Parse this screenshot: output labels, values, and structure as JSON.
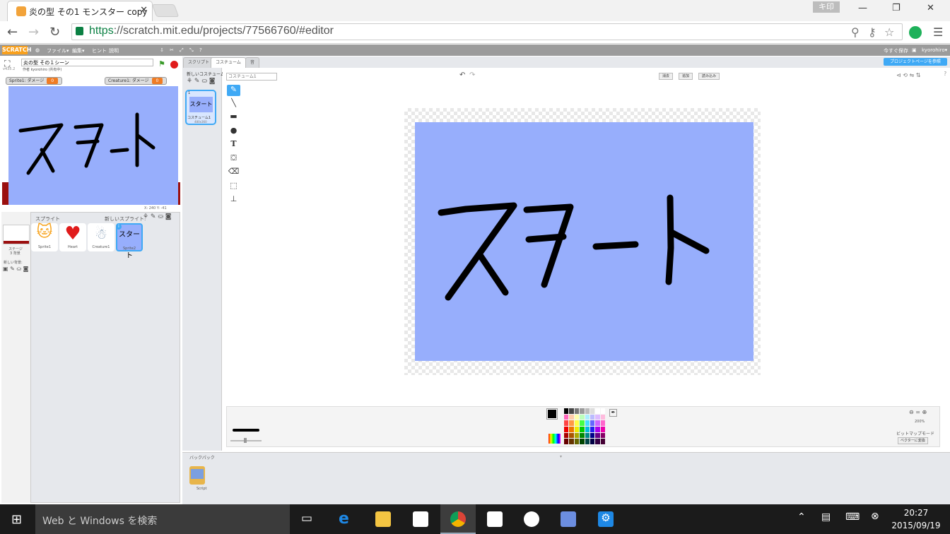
{
  "browser": {
    "tab_title": "炎の型 その1 モンスター copy",
    "tab_close": "✕",
    "user_badge": "キ印",
    "url_scheme": "https",
    "url_rest": "://scratch.mit.edu/projects/77566760/#editor",
    "minimize": "—",
    "restore": "❐",
    "close": "✕"
  },
  "scratch": {
    "logo": "SCRATCH",
    "menus": [
      "ファイル▾",
      "編集▾",
      "ヒント",
      "説明"
    ],
    "save_now": "今すぐ保存",
    "username": "kyorohiro▾",
    "project_page_btn": "プロジェクトページを参照",
    "project_title": "炎の型 その１シーン",
    "author": "作者 kyorohiro (共有中)",
    "version": "v435.2",
    "monitors": {
      "sprite1_label": "Sprite1: ダメージ",
      "sprite1_value": "0",
      "creature_label": "Creature1: ダメージ",
      "creature_value": "0"
    },
    "coords": "X: 240  Y: -41",
    "stage_text": "スタート",
    "sprites_header": "スプライト",
    "new_sprite": "新しいスプライト:",
    "stage_label": "ステージ",
    "stage_bg_count": "3 背景",
    "new_backdrop": "新しい背景:",
    "sprites": [
      "Sprite1",
      "Heart",
      "Creature1",
      "Sprite2"
    ],
    "tabs": {
      "scripts": "スクリプト",
      "costumes": "コスチューム",
      "sounds": "音"
    },
    "new_costume": "新しいコスチューム:",
    "costume_name_placeholder": "コスチューム1",
    "costume_thumb_label": "コスチューム1",
    "costume_thumb_size": "480x360",
    "costume_index": "1",
    "btn_clear": "消去",
    "btn_add": "追加",
    "btn_import": "読み込み",
    "zoom_level": "200%",
    "bitmap_mode": "ビットマップモード",
    "convert_vector": "ベクターに変換",
    "backpack_label": "バックパック",
    "backpack_item": "Script"
  },
  "taskbar": {
    "search_placeholder": "Web と Windows を検索",
    "time": "20:27",
    "date": "2015/09/19"
  },
  "colors": {
    "stage_blue": "#97aefc",
    "taskbar": "#1b1b1b",
    "accent": "#3fa9f5"
  }
}
